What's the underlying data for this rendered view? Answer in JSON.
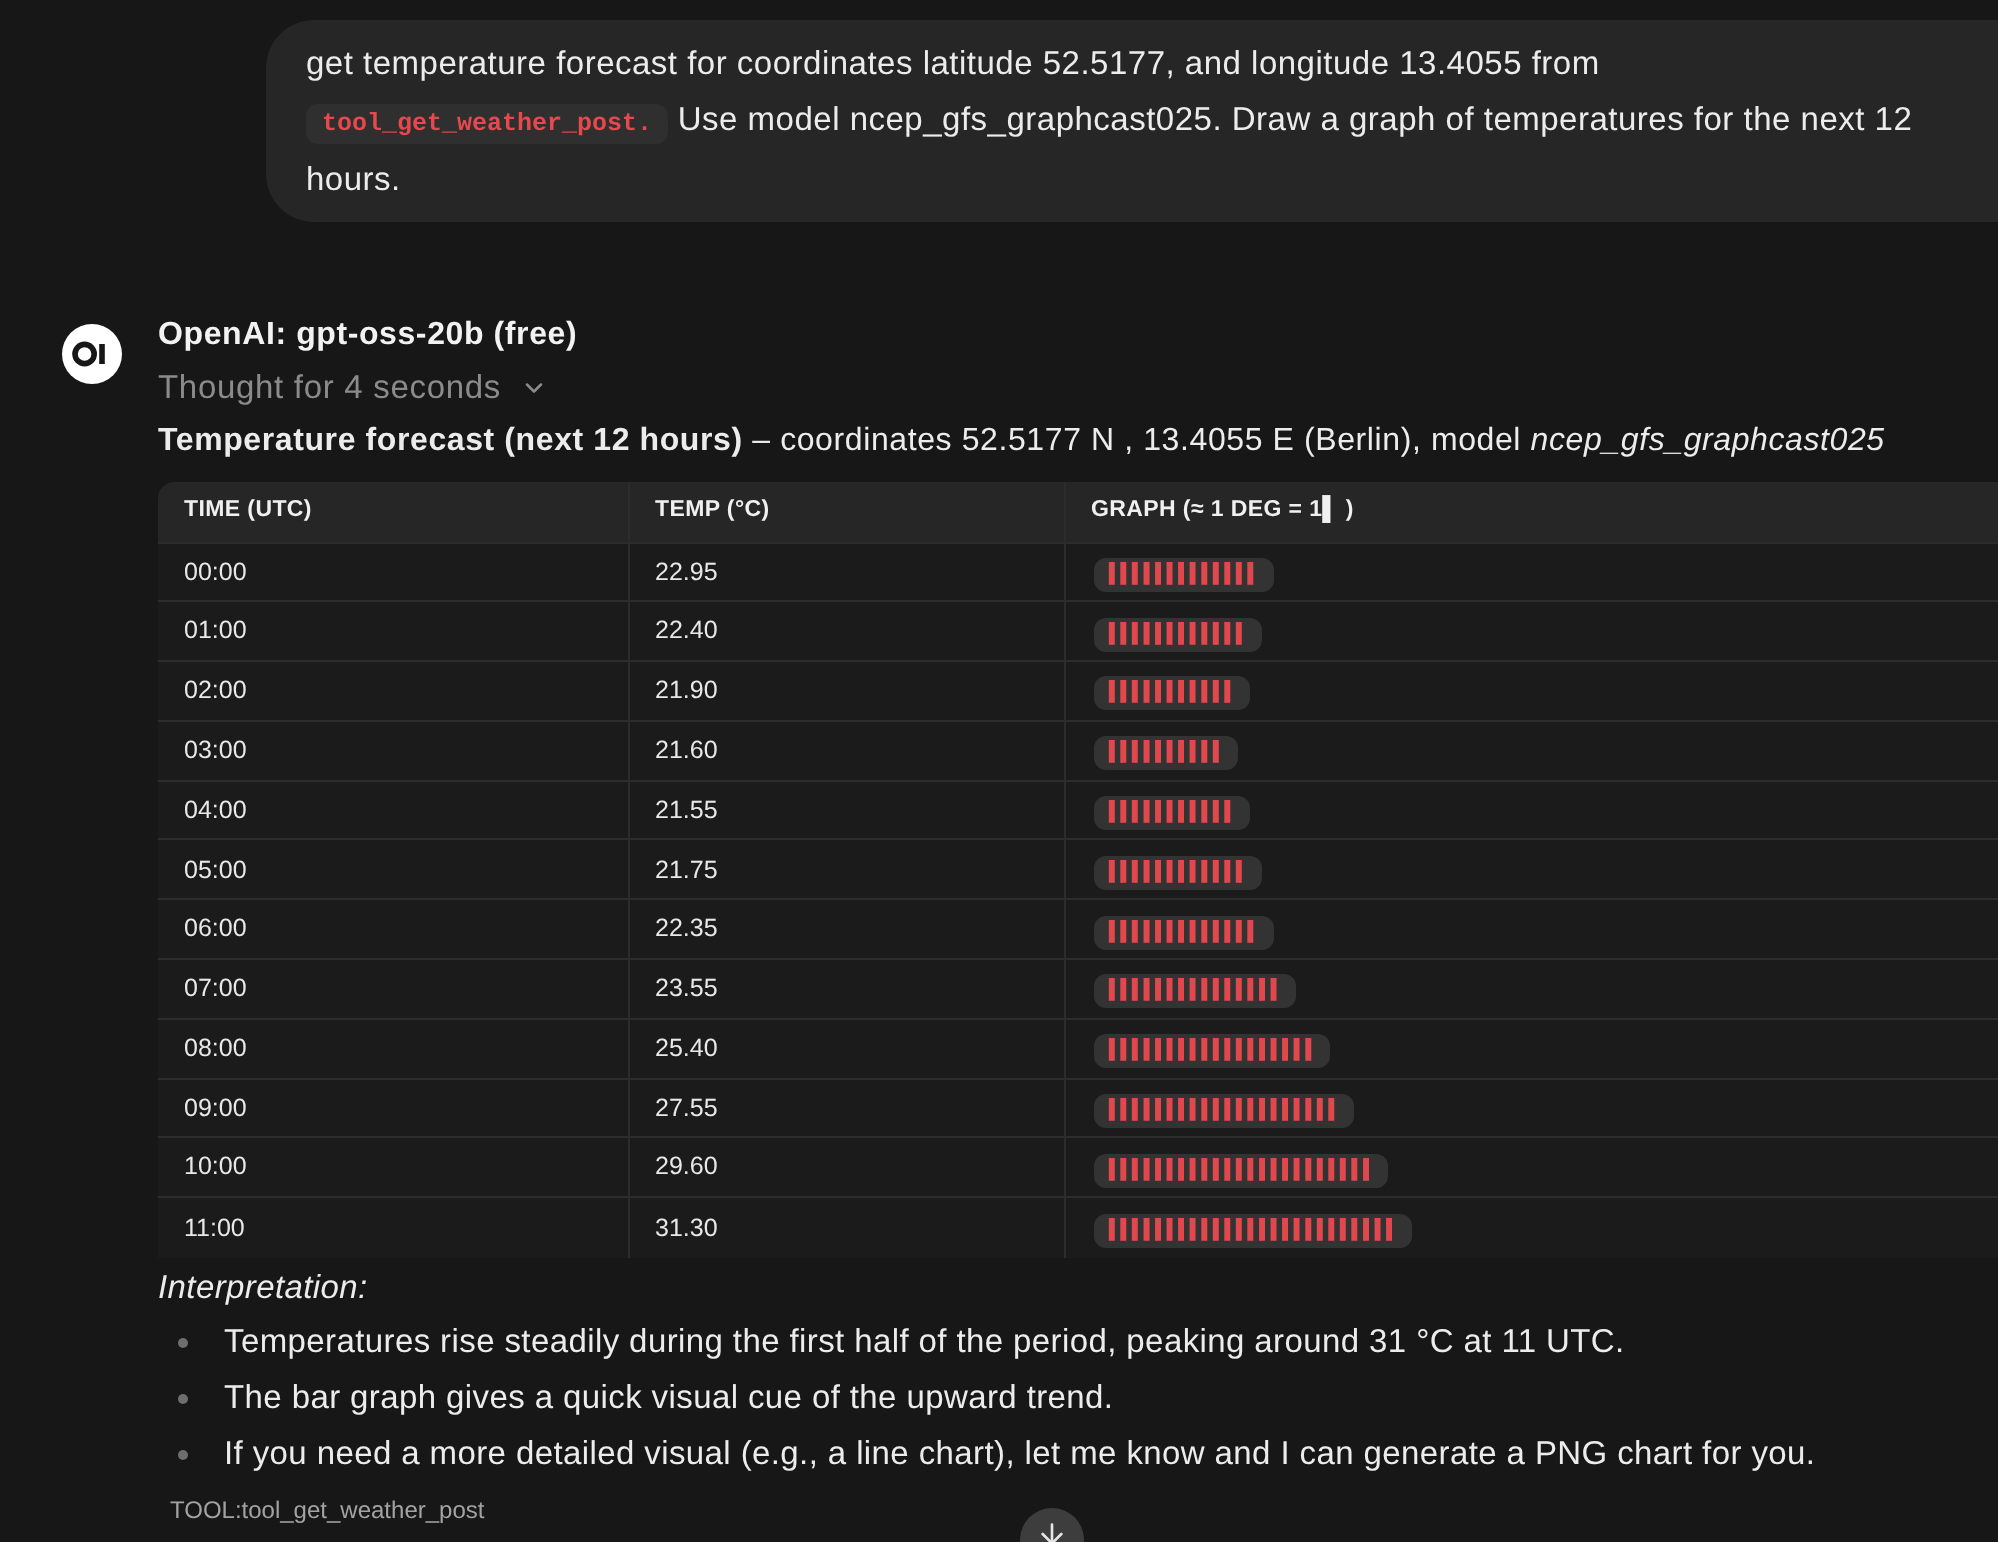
{
  "user_message": {
    "text_before": "get temperature forecast for coordinates latitude 52.5177, and longitude 13.4055 from",
    "code": "tool_get_weather_post.",
    "text_after": "Use model ncep_gfs_graphcast025. Draw a graph of temperatures for the next 12 hours."
  },
  "assistant": {
    "model": "OpenAI: gpt-oss-20b (free)",
    "thought": {
      "label": "Thought for 4 seconds",
      "expanded": false
    },
    "intro": "**Temperature forecast (next 12 hours)** – coordinates 52.5177 N , 13.4055 E (Berlin), model *ncep_gfs_graphcast025*",
    "table": {
      "columns": [
        "TIME (UTC)",
        "TEMP (°C)",
        "GRAPH (≈ 1 DEG = 1▌ )"
      ],
      "rows": [
        {
          "time": "00:00",
          "temp": "22.95",
          "graph": "▌▌▌▌▌▌▌▌▌▌▌▌▌"
        },
        {
          "time": "01:00",
          "temp": "22.40",
          "graph": "▌▌▌▌▌▌▌▌▌▌▌▌"
        },
        {
          "time": "02:00",
          "temp": "21.90",
          "graph": "▌▌▌▌▌▌▌▌▌▌▌"
        },
        {
          "time": "03:00",
          "temp": "21.60",
          "graph": "▌▌▌▌▌▌▌▌▌▌"
        },
        {
          "time": "04:00",
          "temp": "21.55",
          "graph": "▌▌▌▌▌▌▌▌▌▌▌"
        },
        {
          "time": "05:00",
          "temp": "21.75",
          "graph": "▌▌▌▌▌▌▌▌▌▌▌▌"
        },
        {
          "time": "06:00",
          "temp": "22.35",
          "graph": "▌▌▌▌▌▌▌▌▌▌▌▌▌"
        },
        {
          "time": "07:00",
          "temp": "23.55",
          "graph": "▌▌▌▌▌▌▌▌▌▌▌▌▌▌▌"
        },
        {
          "time": "08:00",
          "temp": "25.40",
          "graph": "▌▌▌▌▌▌▌▌▌▌▌▌▌▌▌▌▌▌"
        },
        {
          "time": "09:00",
          "temp": "27.55",
          "graph": "▌▌▌▌▌▌▌▌▌▌▌▌▌▌▌▌▌▌▌▌"
        },
        {
          "time": "10:00",
          "temp": "29.60",
          "graph": "▌▌▌▌▌▌▌▌▌▌▌▌▌▌▌▌▌▌▌▌▌▌▌"
        },
        {
          "time": "11:00",
          "temp": "31.30",
          "graph": "▌▌▌▌▌▌▌▌▌▌▌▌▌▌▌▌▌▌▌▌▌▌▌▌▌"
        }
      ]
    },
    "interpretation": {
      "heading": "Interpretation:",
      "bullets": [
        "Temperatures rise steadily during the first half of the period, peaking around 31 °C at 11 UTC.",
        "The bar graph gives a quick visual cue of the upward trend.",
        "If you need a more detailed visual (e.g., a line chart), let me know and I can generate a PNG chart for you."
      ]
    },
    "tool_label": "TOOL:tool_get_weather_post"
  }
}
